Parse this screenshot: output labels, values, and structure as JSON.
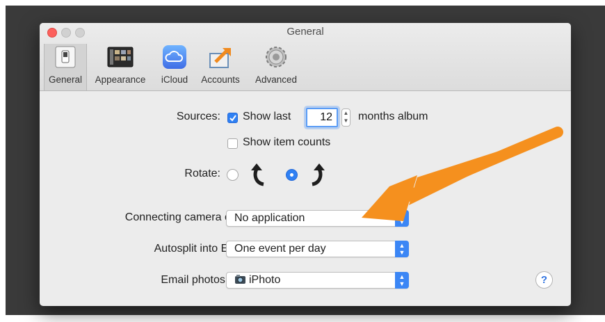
{
  "window": {
    "title": "General"
  },
  "toolbar": {
    "items": [
      {
        "label": "General",
        "icon": "light-switch-icon",
        "selected": true
      },
      {
        "label": "Appearance",
        "icon": "appearance-icon",
        "selected": false
      },
      {
        "label": "iCloud",
        "icon": "icloud-icon",
        "selected": false
      },
      {
        "label": "Accounts",
        "icon": "accounts-icon",
        "selected": false
      },
      {
        "label": "Advanced",
        "icon": "gear-icon",
        "selected": false
      }
    ]
  },
  "sources": {
    "label": "Sources:",
    "show_last_checked": true,
    "show_last_label": "Show last",
    "months_value": "12",
    "months_suffix": "months album",
    "show_item_counts_checked": false,
    "show_item_counts_label": "Show item counts"
  },
  "rotate": {
    "label": "Rotate:",
    "options": [
      {
        "icon": "rotate-counterclockwise-icon",
        "selected": false
      },
      {
        "icon": "rotate-clockwise-icon",
        "selected": true
      }
    ]
  },
  "camera": {
    "label": "Connecting camera opens:",
    "value": "No application"
  },
  "autosplit": {
    "label": "Autosplit into Events:",
    "value": "One event per day"
  },
  "email": {
    "label": "Email photos using:",
    "value": "iPhoto",
    "icon": "iphoto-icon"
  },
  "help": {
    "label": "?"
  },
  "colors": {
    "accent": "#2f80f3",
    "annotation_arrow": "#f5901e"
  }
}
